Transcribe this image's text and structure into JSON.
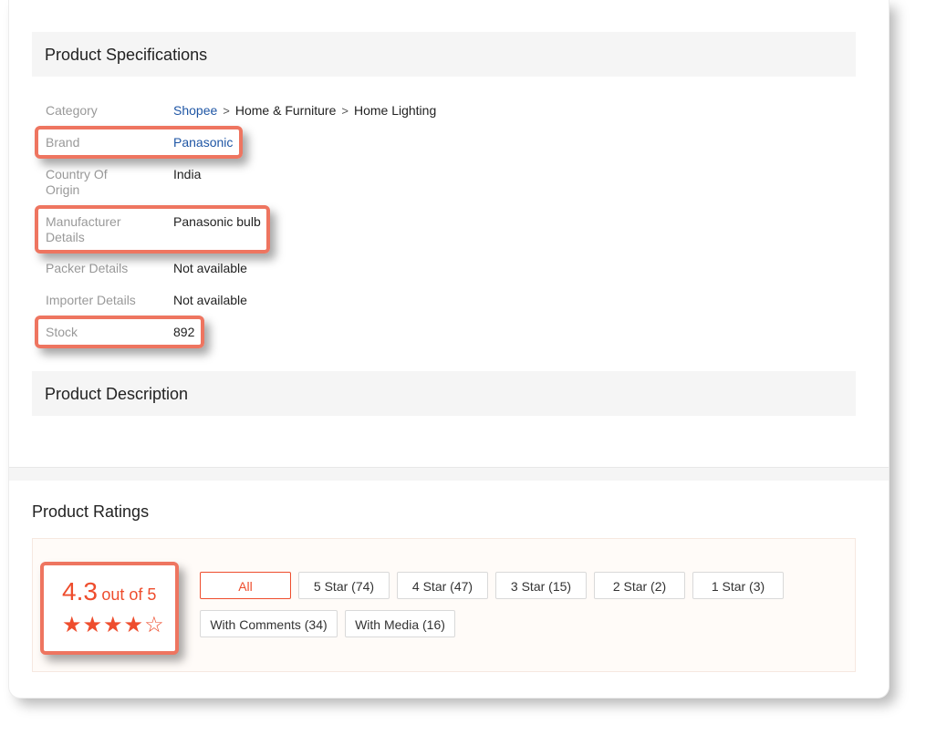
{
  "specifications": {
    "title": "Product Specifications",
    "category_label": "Category",
    "breadcrumb": [
      "Shopee",
      "Home & Furniture",
      "Home Lighting"
    ],
    "breadcrumb_separator": ">",
    "brand_label": "Brand",
    "brand_value": "Panasonic",
    "country_label": "Country Of Origin",
    "country_value": "India",
    "manufacturer_label": "Manufacturer Details",
    "manufacturer_value": "Panasonic bulb",
    "packer_label": "Packer Details",
    "packer_value": "Not available",
    "importer_label": "Importer Details",
    "importer_value": "Not available",
    "stock_label": "Stock",
    "stock_value": "892"
  },
  "description": {
    "title": "Product Description"
  },
  "ratings": {
    "title": "Product Ratings",
    "score": "4.3",
    "score_suffix": "out of 5",
    "stars_display": "★★★★☆",
    "filters": [
      "All",
      "5 Star (74)",
      "4 Star (47)",
      "3 Star (15)",
      "2 Star (2)",
      "1 Star (3)",
      "With Comments (34)",
      "With Media (16)"
    ]
  },
  "colors": {
    "accent": "#ee4d2d",
    "highlight": "#ee7560",
    "link": "#1f56a5"
  }
}
